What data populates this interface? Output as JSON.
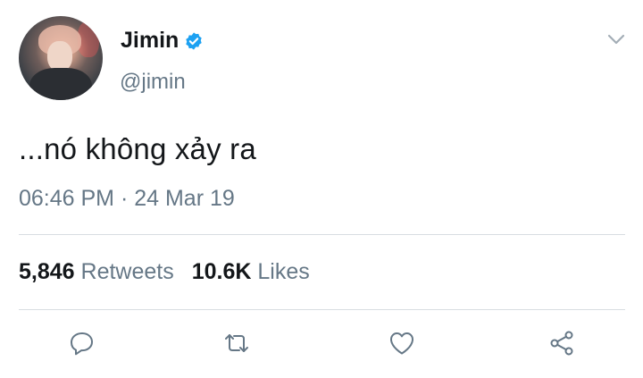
{
  "user": {
    "display_name": "Jimin",
    "handle": "@jimin",
    "verified": true
  },
  "tweet": {
    "text": "...nó không xảy ra",
    "timestamp": "06:46 PM · 24 Mar 19"
  },
  "stats": {
    "retweets_count": "5,846",
    "retweets_label": "Retweets",
    "likes_count": "10.6K",
    "likes_label": "Likes"
  },
  "icons": {
    "verified": "verified-badge-icon",
    "menu": "chevron-down-icon",
    "reply": "reply-icon",
    "retweet": "retweet-icon",
    "like": "heart-icon",
    "share": "share-icon"
  },
  "colors": {
    "text_primary": "#14171a",
    "text_secondary": "#657786",
    "verified_blue": "#1da1f2",
    "divider": "#d8dde2"
  }
}
